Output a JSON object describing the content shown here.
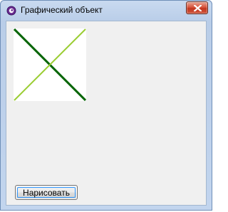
{
  "window": {
    "title": "Графический объект",
    "close_icon": "close-icon",
    "app_icon": "app-icon"
  },
  "canvas": {
    "lines": [
      {
        "name": "dark-green-diagonal",
        "color": "#006400",
        "direction": "top-left to bottom-right"
      },
      {
        "name": "light-green-diagonal",
        "color": "#9acd32",
        "direction": "top-right to bottom-left"
      }
    ]
  },
  "buttons": {
    "draw_label": "Нарисовать"
  },
  "colors": {
    "client_background": "#f0f0f0",
    "canvas_background": "#ffffff"
  }
}
